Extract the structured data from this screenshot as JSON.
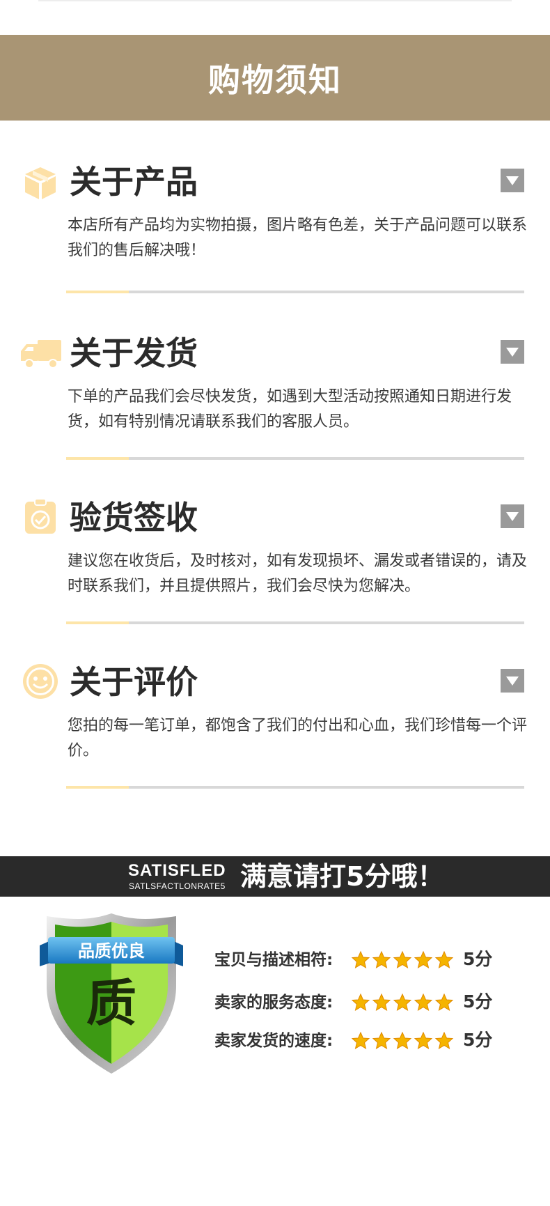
{
  "banner": {
    "title": "购物须知"
  },
  "sections": [
    {
      "title": "关于产品",
      "icon": "box-icon",
      "text": "本店所有产品均为实物拍摄，图片略有色差，关于产品问题可以联系我们的售后解决哦！"
    },
    {
      "title": "关于发货",
      "icon": "truck-icon",
      "text": "下单的产品我们会尽快发货，如遇到大型活动按照通知日期进行发货，如有特别情况请联系我们的客服人员。"
    },
    {
      "title": "验货签收",
      "icon": "clipboard-check-icon",
      "text": "建议您在收货后，及时核对，如有发现损坏、漏发或者错误的，请及时联系我们，并且提供照片，我们会尽快为您解决。"
    },
    {
      "title": "关于评价",
      "icon": "smiley-icon",
      "text": "您拍的每一笔订单，都饱含了我们的付出和心血，我们珍惜每一个评价。"
    }
  ],
  "rating_banner": {
    "en": "SATISFLED",
    "en_sub": "SATLSFACTLONRATE5",
    "cn": "满意请打5分哦！"
  },
  "badge": {
    "ribbon": "品质优良",
    "char": "质"
  },
  "ratings": [
    {
      "label": "宝贝与描述相符:",
      "stars": 5,
      "score": "5分"
    },
    {
      "label": "卖家的服务态度:",
      "stars": 5,
      "score": "5分"
    },
    {
      "label": "卖家发货的速度:",
      "stars": 5,
      "score": "5分"
    }
  ],
  "colors": {
    "banner": "#a99574",
    "accent": "#fde5a9",
    "icon": "#fde0a6",
    "dark_bar": "#2a2a2a",
    "star": "#f5b400",
    "shield_green": "#5cb81e"
  }
}
